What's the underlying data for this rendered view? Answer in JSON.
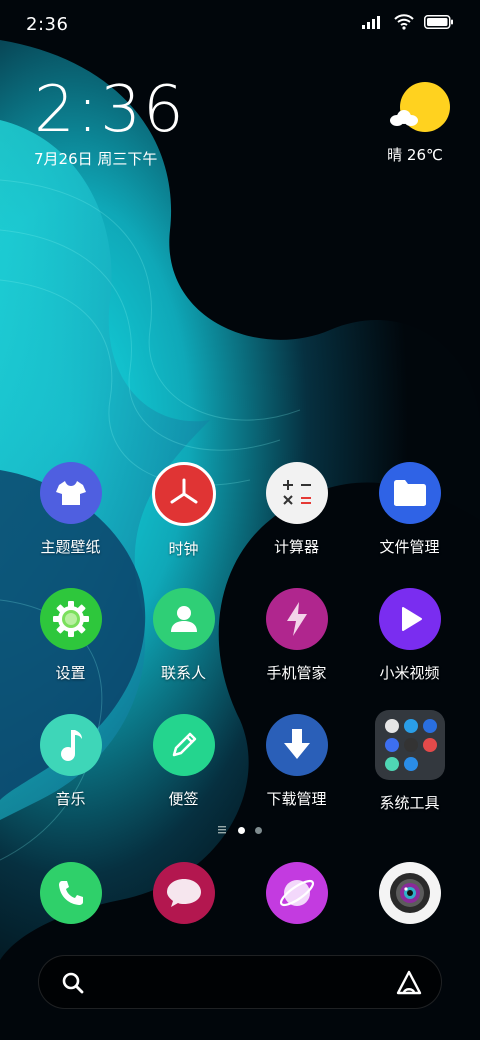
{
  "status_bar": {
    "time": "2:36"
  },
  "clock_widget": {
    "time": "2:36",
    "date": "7月26日 周三下午"
  },
  "weather": {
    "text": "晴 26℃",
    "icon": "sunny-cloud-icon"
  },
  "apps": [
    {
      "label": "主题壁纸",
      "icon": "tshirt-icon",
      "color": "#4f5fe0"
    },
    {
      "label": "时钟",
      "icon": "clock-icon",
      "color": "#e03434"
    },
    {
      "label": "计算器",
      "icon": "calculator-icon",
      "color": "#f2f2f2"
    },
    {
      "label": "文件管理",
      "icon": "folder-icon",
      "color": "#2f63e6"
    },
    {
      "label": "设置",
      "icon": "gear-icon",
      "color": "#2ec73c"
    },
    {
      "label": "联系人",
      "icon": "person-icon",
      "color": "#2fcf76"
    },
    {
      "label": "手机管家",
      "icon": "lightning-icon",
      "color": "#b0268e"
    },
    {
      "label": "小米视频",
      "icon": "play-icon",
      "color": "#7a2df0"
    },
    {
      "label": "音乐",
      "icon": "music-note-icon",
      "color": "#3ed6b8"
    },
    {
      "label": "便签",
      "icon": "pencil-icon",
      "color": "#24d58e"
    },
    {
      "label": "下载管理",
      "icon": "download-icon",
      "color": "#2a5fb8"
    },
    {
      "label": "系统工具",
      "icon": "folder-grid-icon",
      "color": "#3c4248"
    }
  ],
  "dock": [
    {
      "name": "phone",
      "icon": "phone-icon",
      "color": "#2fd06a"
    },
    {
      "name": "messages",
      "icon": "chat-bubble-icon",
      "color": "#b3174f"
    },
    {
      "name": "browser",
      "icon": "globe-icon",
      "color": "#c33be0"
    },
    {
      "name": "camera",
      "icon": "camera-lens-icon",
      "color": "#f4f4f4"
    }
  ],
  "page_indicator": {
    "pages": 2,
    "active": 0
  },
  "search_bar": {
    "search_icon": "search-icon",
    "assistant_icon": "assistant-icon"
  }
}
